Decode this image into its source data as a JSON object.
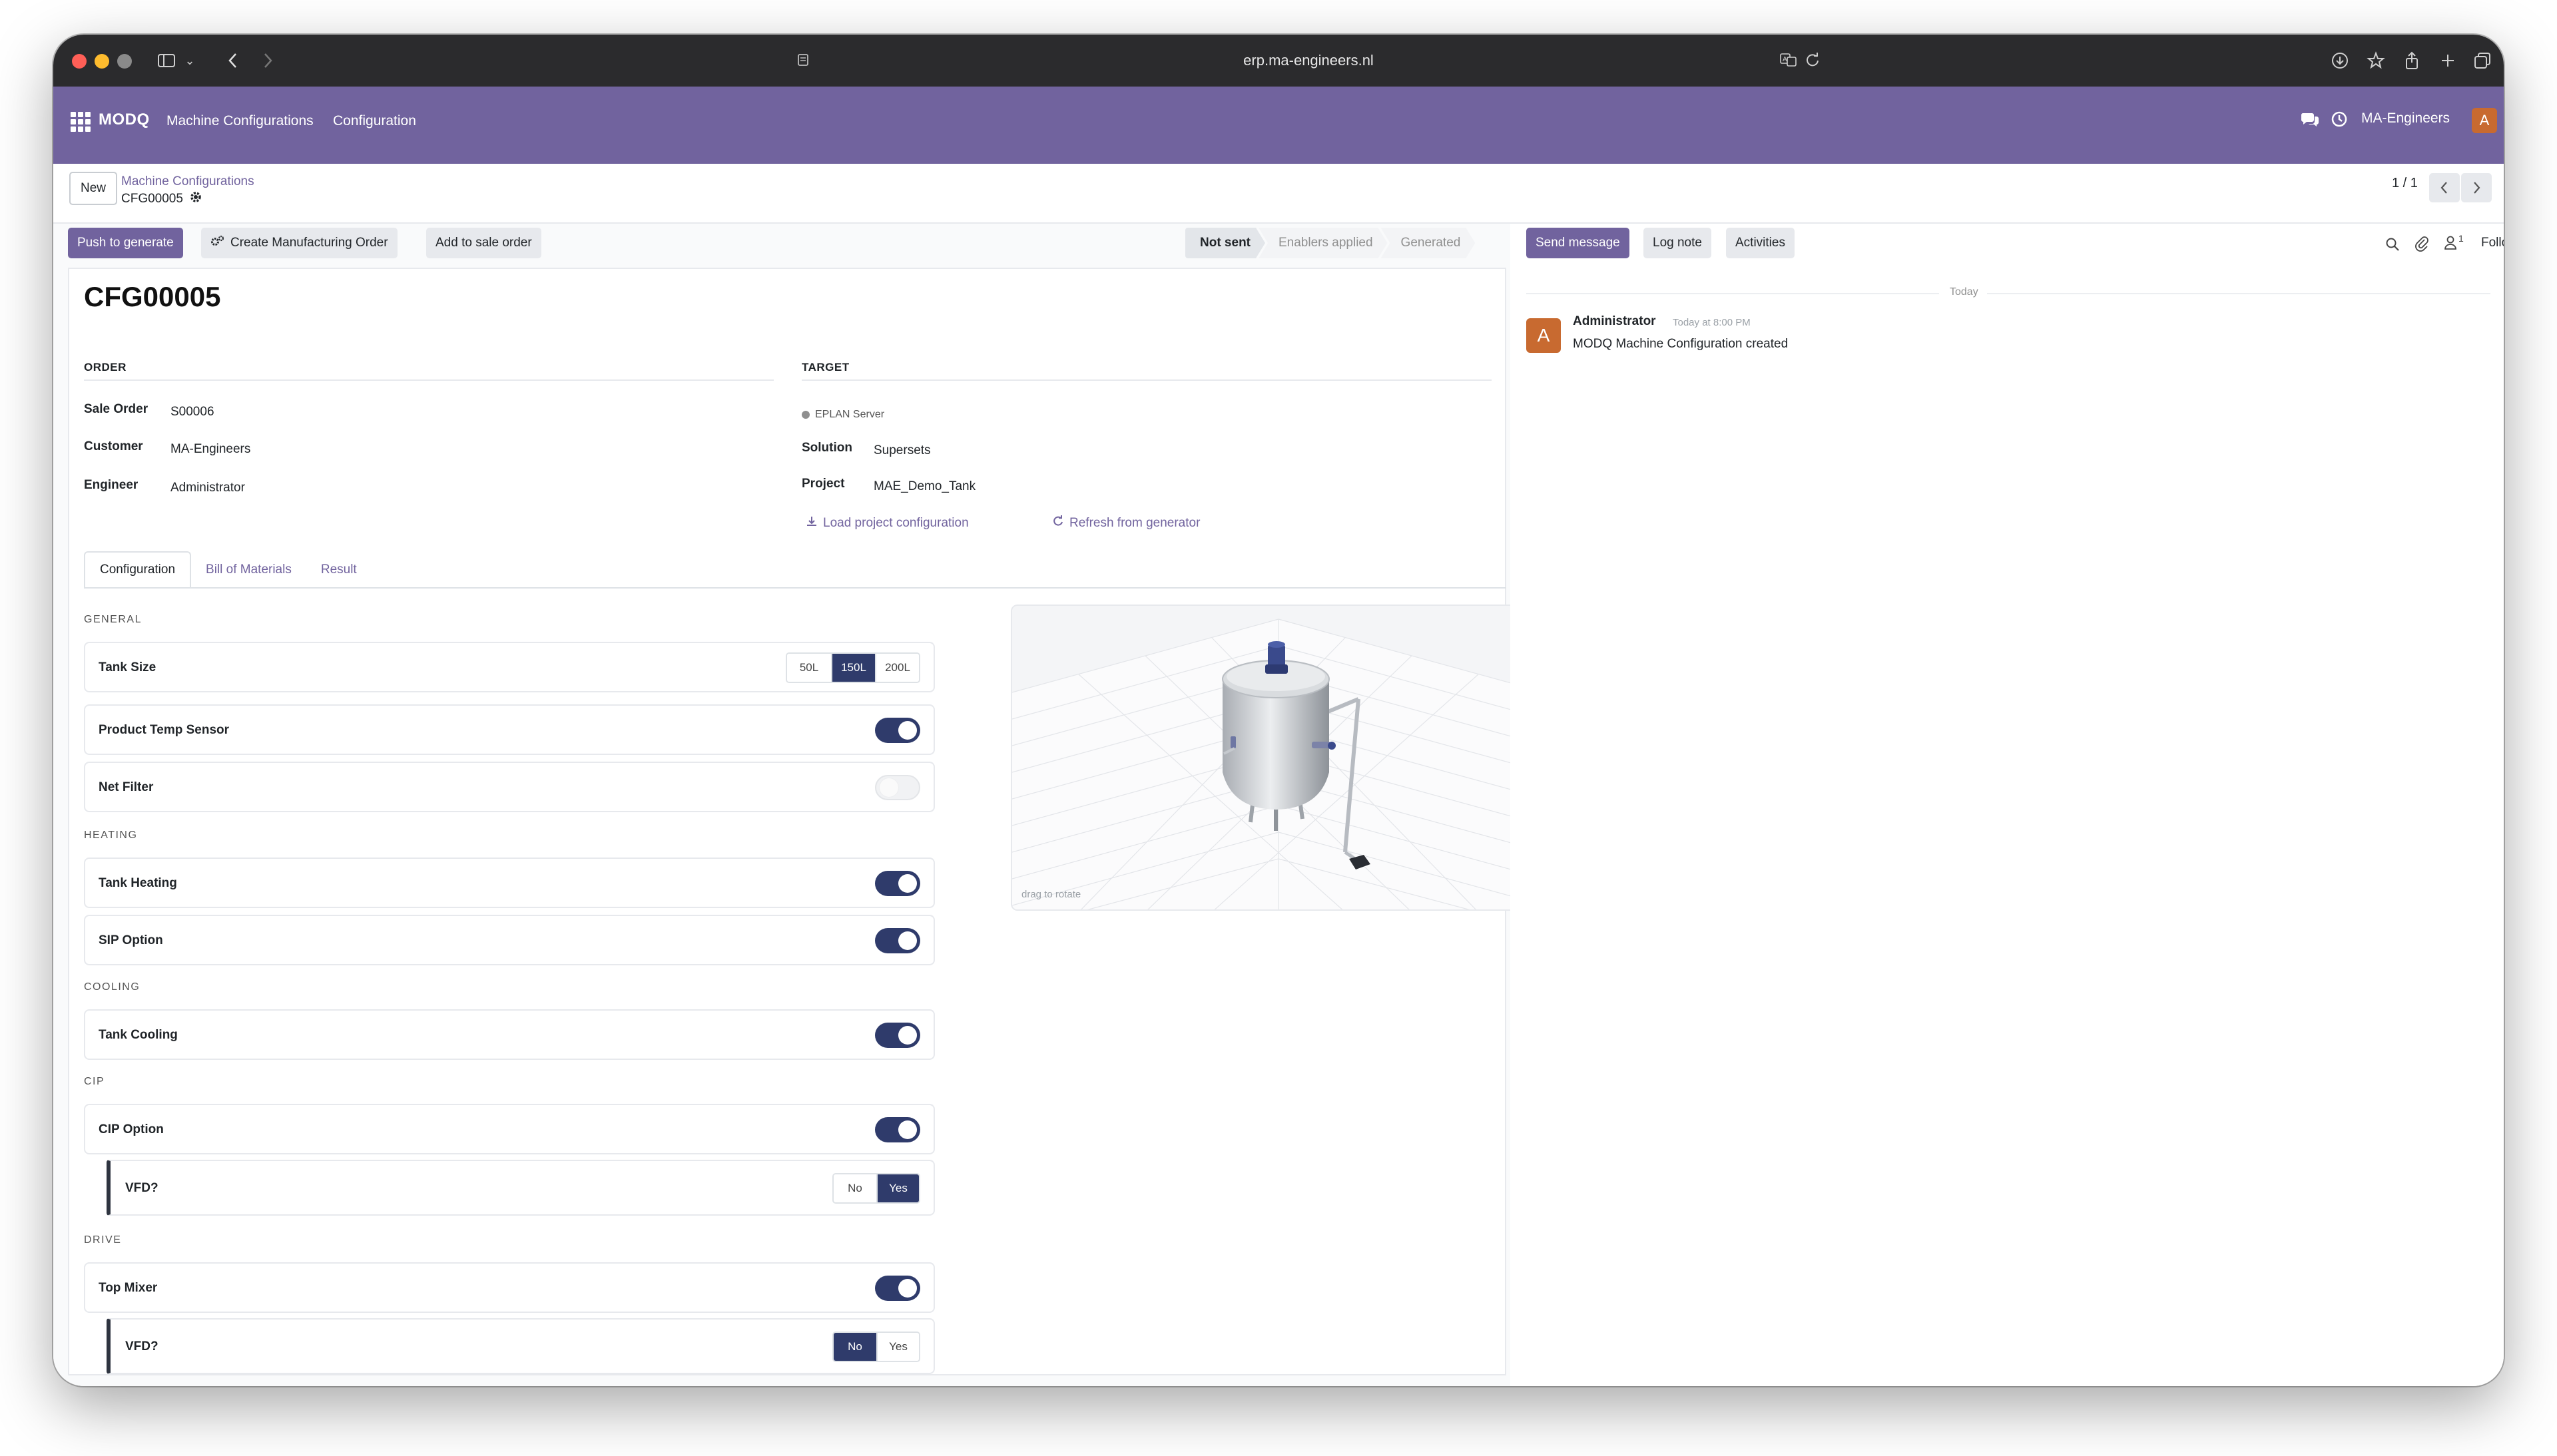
{
  "browser": {
    "url": "erp.ma-engineers.nl"
  },
  "navbar": {
    "brand": "MODQ",
    "menu": [
      "Machine Configurations",
      "Configuration"
    ],
    "company": "MA-Engineers",
    "user_initial": "A"
  },
  "control_panel": {
    "new_label": "New",
    "breadcrumb_parent": "Machine Configurations",
    "breadcrumb_current": "CFG00005",
    "pager": "1 / 1"
  },
  "actions": {
    "push_label": "Push to generate",
    "create_mo_label": "Create Manufacturing Order",
    "add_sale_label": "Add to sale order"
  },
  "statusbar": [
    "Not sent",
    "Enablers applied",
    "Generated"
  ],
  "chatter_actions": {
    "send_label": "Send message",
    "log_label": "Log note",
    "activities_label": "Activities",
    "followers_count": "1",
    "following_label": "Following"
  },
  "form": {
    "title": "CFG00005",
    "order_section": "ORDER",
    "target_section": "TARGET",
    "sale_order_label": "Sale Order",
    "sale_order_value": "S00006",
    "customer_label": "Customer",
    "customer_value": "MA-Engineers",
    "engineer_label": "Engineer",
    "engineer_value": "Administrator",
    "target_status": "EPLAN Server",
    "solution_label": "Solution",
    "solution_value": "Supersets",
    "project_label": "Project",
    "project_value": "MAE_Demo_Tank",
    "load_label": "Load project configuration",
    "refresh_label": "Refresh from generator"
  },
  "tabs": [
    "Configuration",
    "Bill of Materials",
    "Result"
  ],
  "config": {
    "general": "GENERAL",
    "tank_size_label": "Tank Size",
    "tank_sizes": [
      "50L",
      "150L",
      "200L"
    ],
    "tank_size_selected": "150L",
    "product_temp_label": "Product Temp Sensor",
    "product_temp_on": true,
    "net_filter_label": "Net Filter",
    "net_filter_on": false,
    "heating": "HEATING",
    "tank_heating_label": "Tank Heating",
    "tank_heating_on": true,
    "sip_label": "SIP Option",
    "sip_on": true,
    "cooling": "COOLING",
    "tank_cooling_label": "Tank Cooling",
    "tank_cooling_on": true,
    "cip": "CIP",
    "cip_label": "CIP Option",
    "cip_on": true,
    "cip_vfd_label": "VFD?",
    "cip_vfd_options": [
      "No",
      "Yes"
    ],
    "cip_vfd_selected": "Yes",
    "drive": "DRIVE",
    "top_mixer_label": "Top Mixer",
    "top_mixer_on": true,
    "mixer_vfd_label": "VFD?",
    "mixer_vfd_options": [
      "No",
      "Yes"
    ],
    "mixer_vfd_selected": "No"
  },
  "viewer": {
    "hint": "drag to rotate"
  },
  "chatter": {
    "day_label": "Today",
    "author": "Administrator",
    "time": "Today at 8:00 PM",
    "avatar_initial": "A",
    "body": "MODQ Machine Configuration created"
  },
  "colors": {
    "brand": "#71639e",
    "toggle_on": "#2f3b6b",
    "avatar": "#c86a30"
  }
}
